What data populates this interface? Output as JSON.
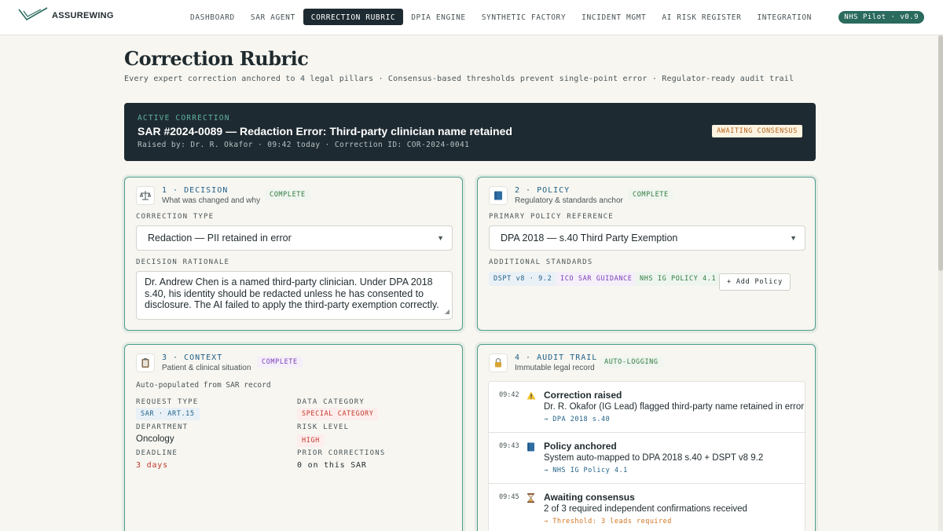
{
  "app": {
    "name": "ASSUREWING",
    "version_pill": "NHS Pilot · v0.9"
  },
  "nav": [
    {
      "label": "DASHBOARD"
    },
    {
      "label": "SAR AGENT"
    },
    {
      "label": "CORRECTION RUBRIC",
      "active": true
    },
    {
      "label": "DPIA ENGINE"
    },
    {
      "label": "SYNTHETIC FACTORY"
    },
    {
      "label": "INCIDENT MGMT"
    },
    {
      "label": "AI RISK REGISTER"
    },
    {
      "label": "INTEGRATION"
    }
  ],
  "page": {
    "title": "Correction Rubric",
    "subtitle": "Every expert correction anchored to 4 legal pillars · Consensus-based thresholds prevent single-point error · Regulator-ready audit trail"
  },
  "active_correction": {
    "kicker": "ACTIVE CORRECTION",
    "title": "SAR #2024-0089 — Redaction Error: Third-party clinician name retained",
    "meta": "Raised by: Dr. R. Okafor · 09:42 today · Correction ID: COR-2024-0041",
    "status": "AWAITING CONSENSUS"
  },
  "decision": {
    "number": "1 · DECISION",
    "desc": "What was changed and why",
    "status": "COMPLETE",
    "icon": "scales-icon",
    "type_label": "CORRECTION TYPE",
    "type_value": "Redaction — PII retained in error",
    "rationale_label": "DECISION RATIONALE",
    "rationale": "Dr. Andrew Chen is a named third-party clinician. Under DPA 2018 s.40, his identity should be redacted unless he has consented to disclosure. The AI failed to apply the third-party exemption correctly."
  },
  "policy": {
    "number": "2 · POLICY",
    "desc": "Regulatory & standards anchor",
    "status": "COMPLETE",
    "icon": "book-icon",
    "ref_label": "PRIMARY POLICY REFERENCE",
    "ref_value": "DPA 2018 — s.40 Third Party Exemption",
    "standards_label": "ADDITIONAL STANDARDS",
    "standards": [
      "DSPT v8 · 9.2",
      "ICO SAR GUIDANCE",
      "NHS IG POLICY 4.1"
    ],
    "add_label": "+ Add Policy"
  },
  "context": {
    "number": "3 · CONTEXT",
    "desc": "Patient & clinical situation",
    "status": "COMPLETE",
    "icon": "clipboard-icon",
    "note": "Auto-populated from SAR record",
    "request_type_label": "REQUEST TYPE",
    "request_type": "SAR · ART.15",
    "data_category_label": "DATA CATEGORY",
    "data_category": "SPECIAL CATEGORY",
    "department_label": "DEPARTMENT",
    "department": "Oncology",
    "risk_level_label": "RISK LEVEL",
    "risk_level": "HIGH",
    "deadline_label": "DEADLINE",
    "deadline": "3 days",
    "prior_label": "PRIOR CORRECTIONS",
    "prior": "0 on this SAR"
  },
  "audit": {
    "number": "4 · AUDIT TRAIL",
    "desc": "Immutable legal record",
    "status": "AUTO-LOGGING",
    "icon": "lock-icon",
    "events": [
      {
        "time": "09:42",
        "icon": "warning-icon",
        "title": "Correction raised",
        "desc": "Dr. R. Okafor (IG Lead) flagged third-party name retained in error",
        "ref": "→ DPA 2018 s.40"
      },
      {
        "time": "09:43",
        "icon": "book-icon",
        "title": "Policy anchored",
        "desc": "System auto-mapped to DPA 2018 s.40 + DSPT v8 9.2",
        "ref": "→ NHS IG Policy 4.1"
      },
      {
        "time": "09:45",
        "icon": "hourglass-icon",
        "title": "Awaiting consensus",
        "desc": "2 of 3 required independent confirmations received",
        "ref": "→ Threshold: 3 leads required"
      }
    ]
  }
}
